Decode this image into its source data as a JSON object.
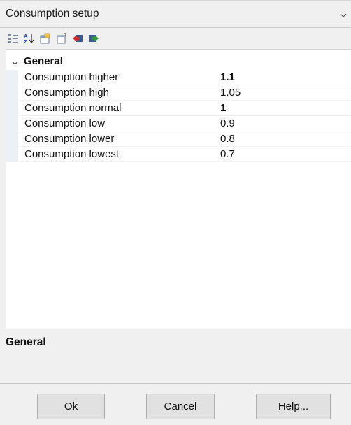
{
  "window": {
    "title": "Consumption setup"
  },
  "toolbar": {
    "buttons": [
      {
        "icon": "categorized-icon"
      },
      {
        "icon": "alphabetical-sort-icon"
      },
      {
        "icon": "property-pages-icon"
      },
      {
        "icon": "new-page-icon"
      },
      {
        "icon": "red-arrow-icon"
      },
      {
        "icon": "green-arrow-icon"
      }
    ]
  },
  "grid": {
    "group": {
      "label": "General",
      "expanded": true
    },
    "properties": [
      {
        "name": "Consumption higher",
        "value": "1.1",
        "modified": true
      },
      {
        "name": "Consumption high",
        "value": "1.05",
        "modified": false
      },
      {
        "name": "Consumption normal",
        "value": "1",
        "modified": true
      },
      {
        "name": "Consumption low",
        "value": "0.9",
        "modified": false
      },
      {
        "name": "Consumption lower",
        "value": "0.8",
        "modified": false
      },
      {
        "name": "Consumption lowest",
        "value": "0.7",
        "modified": false
      }
    ]
  },
  "description": {
    "title": "General"
  },
  "buttons": {
    "ok": "Ok",
    "cancel": "Cancel",
    "help": "Help..."
  },
  "colors": {
    "background": "#f0f0f0",
    "grid_background": "#ffffff",
    "gutter": "#edf0f5"
  }
}
